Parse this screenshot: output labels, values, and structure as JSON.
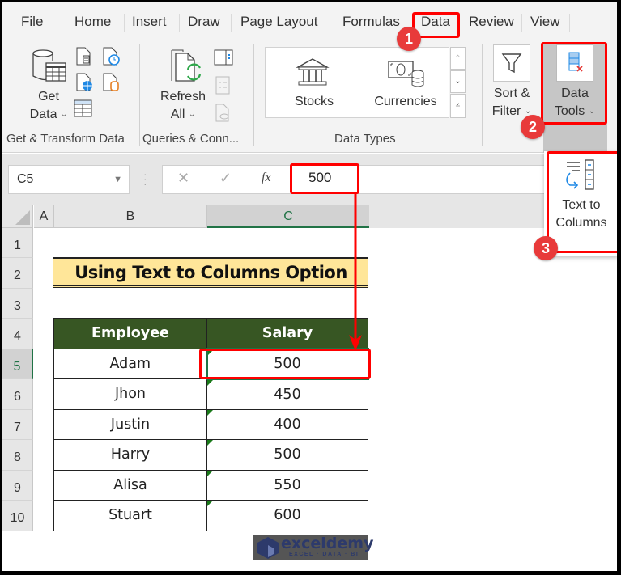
{
  "ribbon": {
    "tabs": [
      {
        "label": "File"
      },
      {
        "label": "Home"
      },
      {
        "label": "Insert"
      },
      {
        "label": "Draw"
      },
      {
        "label": "Page Layout"
      },
      {
        "label": "Formulas"
      },
      {
        "label": "Data",
        "active": true
      },
      {
        "label": "Review"
      },
      {
        "label": "View"
      }
    ],
    "groups": {
      "get_transform": {
        "label": "Get & Transform Data",
        "get_data_line1": "Get",
        "get_data_line2": "Data"
      },
      "queries": {
        "label": "Queries & Conn...",
        "refresh_line1": "Refresh",
        "refresh_line2": "All"
      },
      "data_types": {
        "label": "Data Types",
        "stocks": "Stocks",
        "currencies": "Currencies"
      },
      "sort_filter": {
        "line1": "Sort &",
        "line2": "Filter"
      },
      "data_tools": {
        "line1": "Data",
        "line2": "Tools"
      }
    }
  },
  "popup": {
    "text_to_columns_line1": "Text to",
    "text_to_columns_line2": "Columns"
  },
  "formula_bar": {
    "name_box": "C5",
    "fx_symbol": "fx",
    "cancel_symbol": "✕",
    "enter_symbol": "✓",
    "value": "500"
  },
  "grid": {
    "columns": [
      "A",
      "B",
      "C"
    ],
    "rows": [
      "1",
      "2",
      "3",
      "4",
      "5",
      "6",
      "7",
      "8",
      "9",
      "10"
    ],
    "selected_cell": "C5",
    "title": "Using Text to Columns Option",
    "table": {
      "headers": [
        "Employee",
        "Salary"
      ],
      "rows": [
        {
          "employee": "Adam",
          "salary": "500"
        },
        {
          "employee": "Jhon",
          "salary": "450"
        },
        {
          "employee": "Justin",
          "salary": "400"
        },
        {
          "employee": "Harry",
          "salary": "500"
        },
        {
          "employee": "Alisa",
          "salary": "550"
        },
        {
          "employee": "Stuart",
          "salary": "600"
        }
      ]
    }
  },
  "annotations": {
    "steps": [
      "1",
      "2",
      "3"
    ],
    "color": "#ff0000",
    "badge_color": "#e83a3a"
  },
  "watermark": {
    "name": "exceldemy",
    "tagline": "EXCEL · DATA · BI"
  },
  "colors": {
    "header_fill": "#375623",
    "title_fill": "#ffe699",
    "selection": "#217346"
  }
}
